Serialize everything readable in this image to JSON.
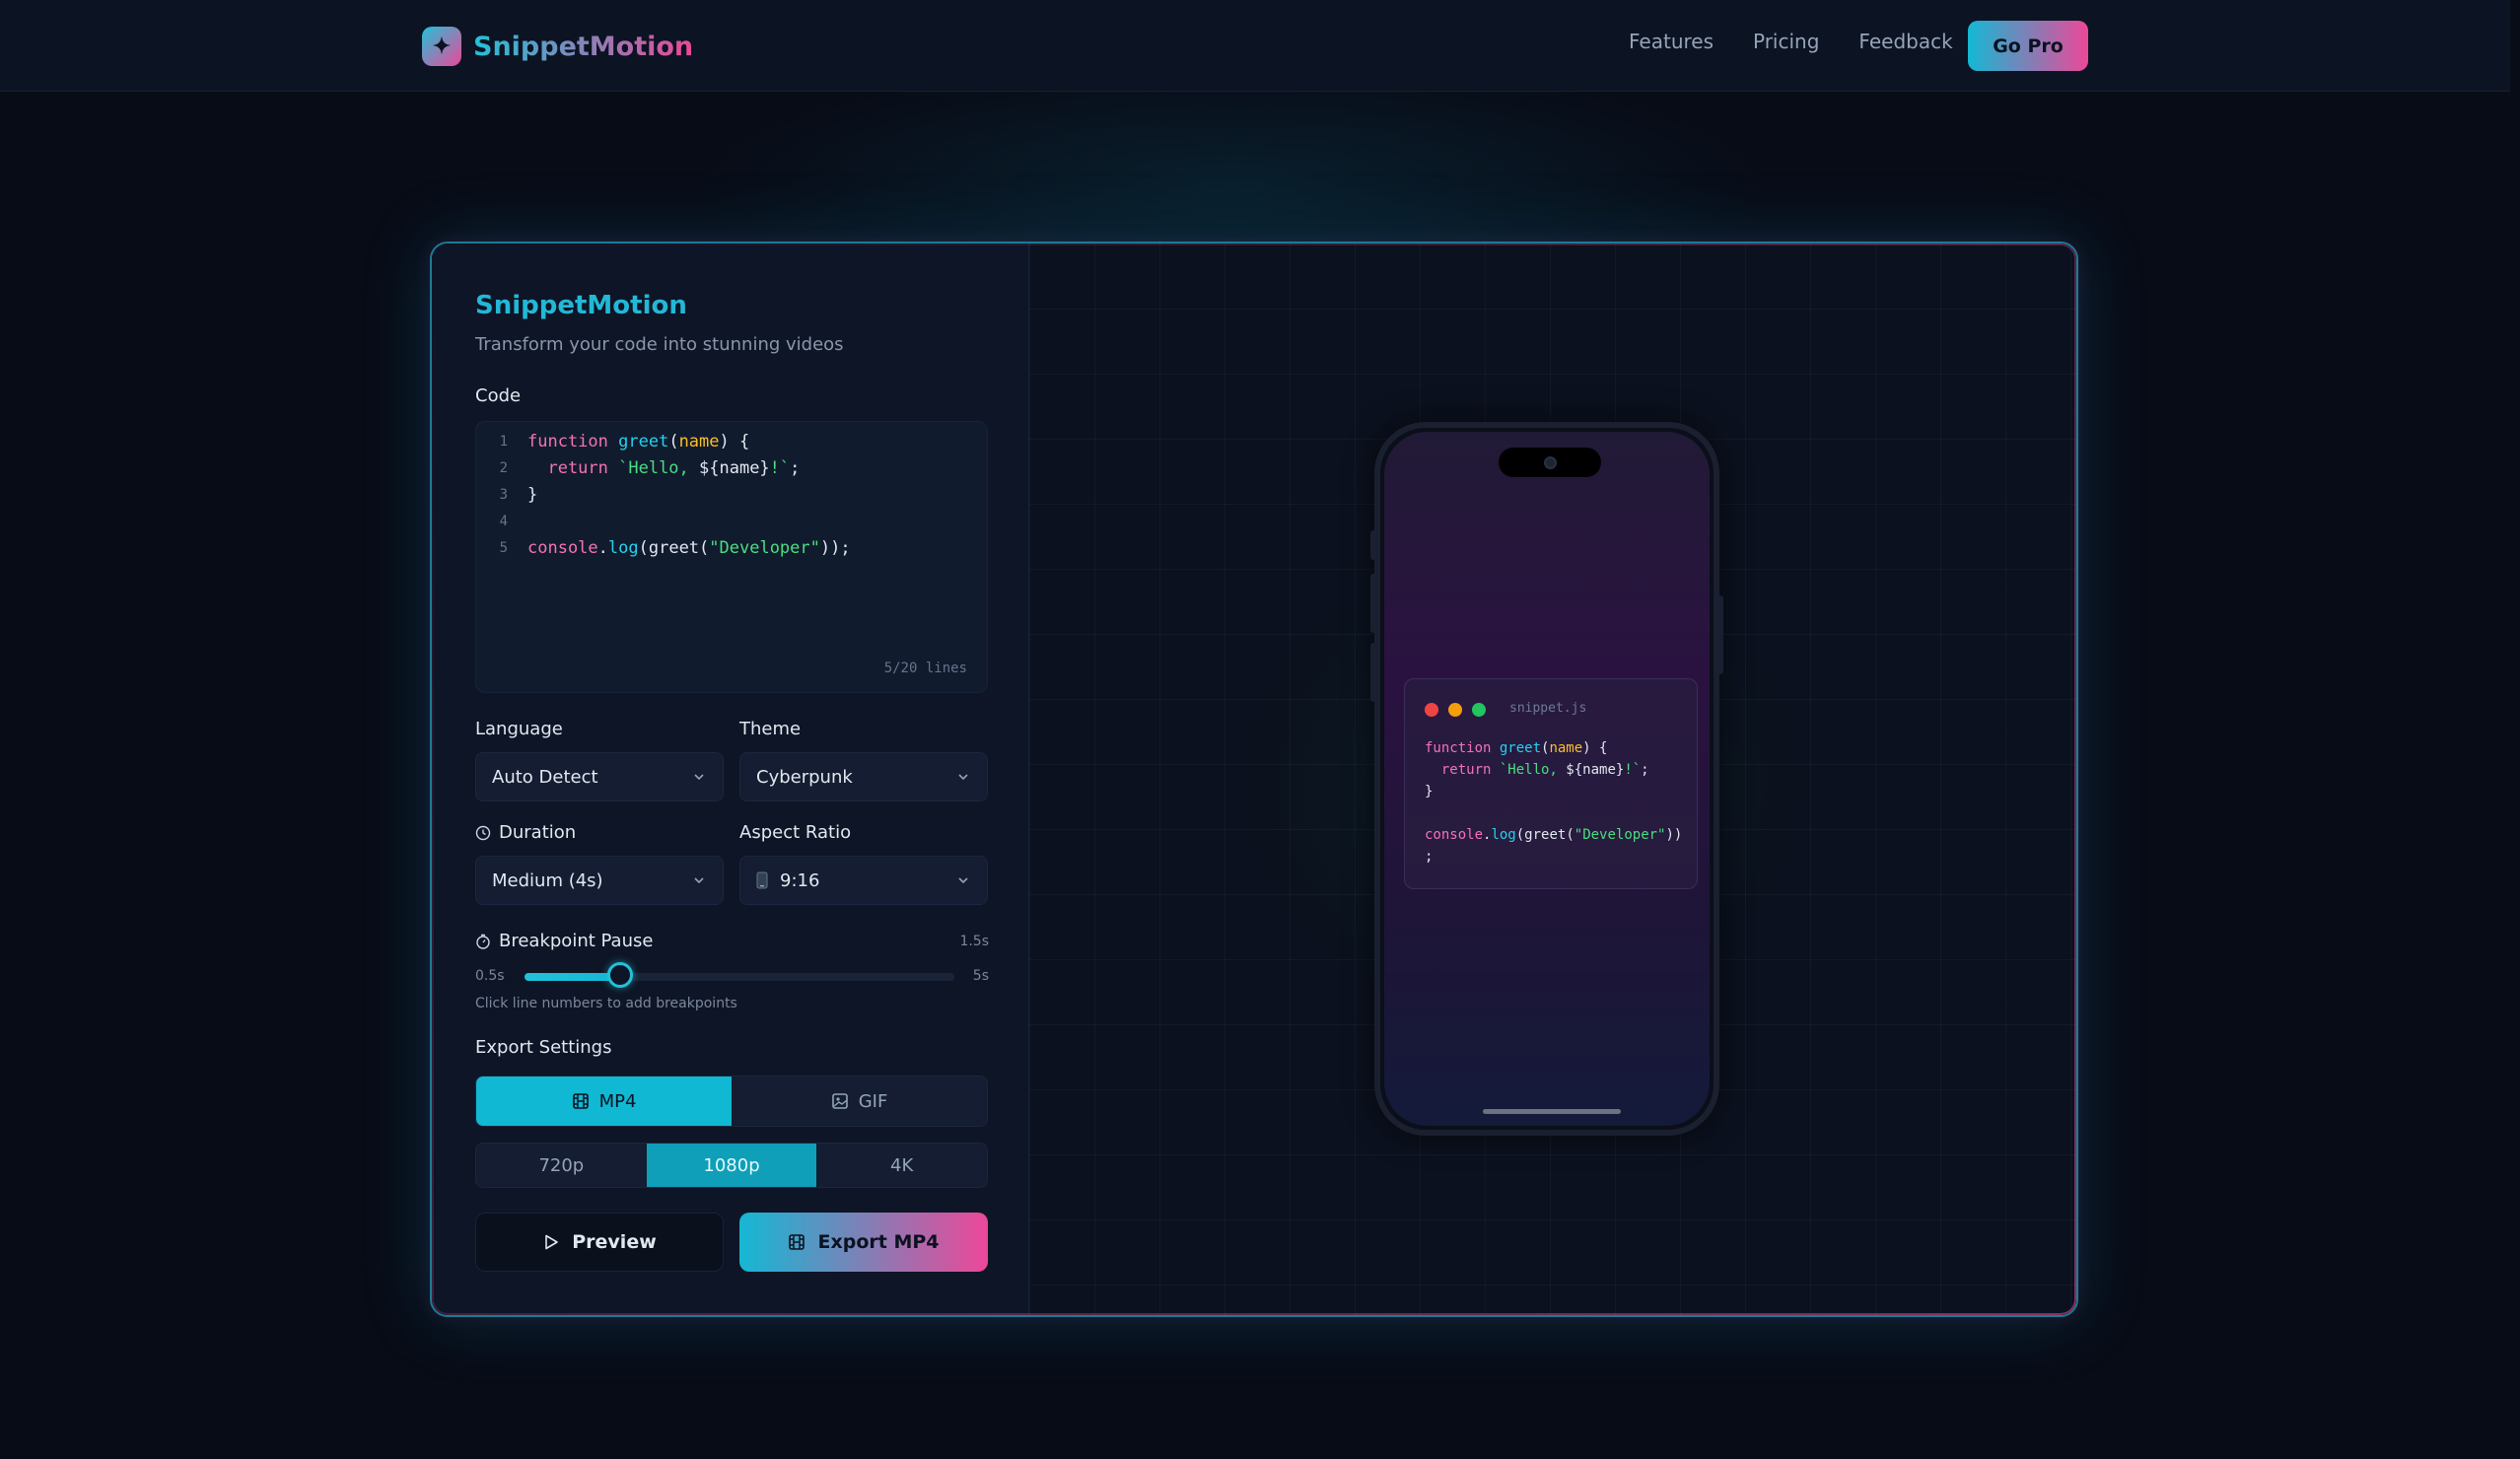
{
  "nav": {
    "brand": "SnippetMotion",
    "links": [
      "Features",
      "Pricing",
      "Feedback"
    ],
    "cta": "Go Pro"
  },
  "panel": {
    "title": "SnippetMotion",
    "subtitle": "Transform your code into stunning videos",
    "code_label": "Code",
    "line_count": "5/20 lines",
    "language_label": "Language",
    "language_value": "Auto Detect",
    "theme_label": "Theme",
    "theme_value": "Cyberpunk",
    "duration_label": "Duration",
    "duration_value": "Medium (4s)",
    "aspect_label": "Aspect Ratio",
    "aspect_value": "9:16",
    "breakpoint_label": "Breakpoint Pause",
    "breakpoint_value": "1.5s",
    "slider_min": "0.5s",
    "slider_max": "5s",
    "slider_fraction": 0.222,
    "breakpoint_hint": "Click line numbers to add breakpoints",
    "export_label": "Export Settings",
    "formats": [
      "MP4",
      "GIF"
    ],
    "active_format": "MP4",
    "resolutions": [
      "720p",
      "1080p",
      "4K"
    ],
    "active_resolution": "1080p",
    "preview_button": "Preview",
    "export_button": "Export MP4"
  },
  "code_lines": [
    {
      "n": "1",
      "tokens": [
        [
          "kw",
          "function "
        ],
        [
          "fn",
          "greet"
        ],
        [
          "pl",
          "("
        ],
        [
          "pa",
          "name"
        ],
        [
          "pl",
          ") {"
        ]
      ]
    },
    {
      "n": "2",
      "tokens": [
        [
          "kw",
          "  return "
        ],
        [
          "st",
          "`Hello, "
        ],
        [
          "pl",
          "${name}"
        ],
        [
          "st",
          "!`"
        ],
        [
          "pl",
          ";"
        ]
      ]
    },
    {
      "n": "3",
      "tokens": [
        [
          "pl",
          "}"
        ]
      ]
    },
    {
      "n": "4",
      "tokens": []
    },
    {
      "n": "5",
      "tokens": [
        [
          "kw",
          "console"
        ],
        [
          "pl",
          "."
        ],
        [
          "fn",
          "log"
        ],
        [
          "pl",
          "(greet("
        ],
        [
          "st",
          "\"Developer\""
        ],
        [
          "pl",
          "));"
        ]
      ]
    }
  ],
  "preview": {
    "filename": "snippet.js",
    "window_dots": [
      "#ef4444",
      "#f59e0b",
      "#22c55e"
    ],
    "lines": [
      [
        [
          "kw",
          "function "
        ],
        [
          "fn",
          "greet"
        ],
        [
          "pl",
          "("
        ],
        [
          "pa",
          "name"
        ],
        [
          "pl",
          ") {"
        ]
      ],
      [
        [
          "kw",
          "  return "
        ],
        [
          "st",
          "`Hello, "
        ],
        [
          "pl",
          "${name}"
        ],
        [
          "st",
          "!`"
        ],
        [
          "pl",
          ";"
        ]
      ],
      [
        [
          "pl",
          "}"
        ]
      ],
      [],
      [
        [
          "kw",
          "console"
        ],
        [
          "pl",
          "."
        ],
        [
          "fn",
          "log"
        ],
        [
          "pl",
          "(greet("
        ],
        [
          "st",
          "\"Developer\""
        ],
        [
          "pl",
          "))"
        ]
      ],
      [
        [
          "pl",
          ";"
        ]
      ]
    ]
  },
  "colors": {
    "accent_cyan": "#14b8d4",
    "accent_pink": "#ec4899",
    "background": "#080c17"
  }
}
